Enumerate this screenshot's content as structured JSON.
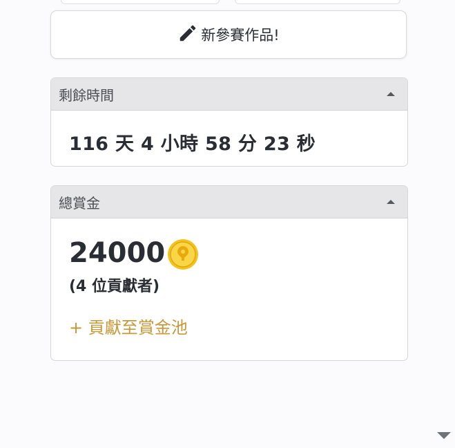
{
  "new_entry": {
    "label": "新參賽作品!",
    "icon": "pencil-icon"
  },
  "time_remaining": {
    "title": "剩餘時間",
    "value": "116 天 4 小時 58 分 23 秒"
  },
  "total_bounty": {
    "title": "總賞金",
    "amount": "24000",
    "coin_icon": "gold-coin-icon",
    "contributors": "(4 位貢獻者)",
    "contribute_link": "+ 貢獻至賞金池"
  },
  "colors": {
    "link_gold": "#c5983a",
    "header_bg": "#e6e6e8",
    "coin": "#f4c21c"
  }
}
